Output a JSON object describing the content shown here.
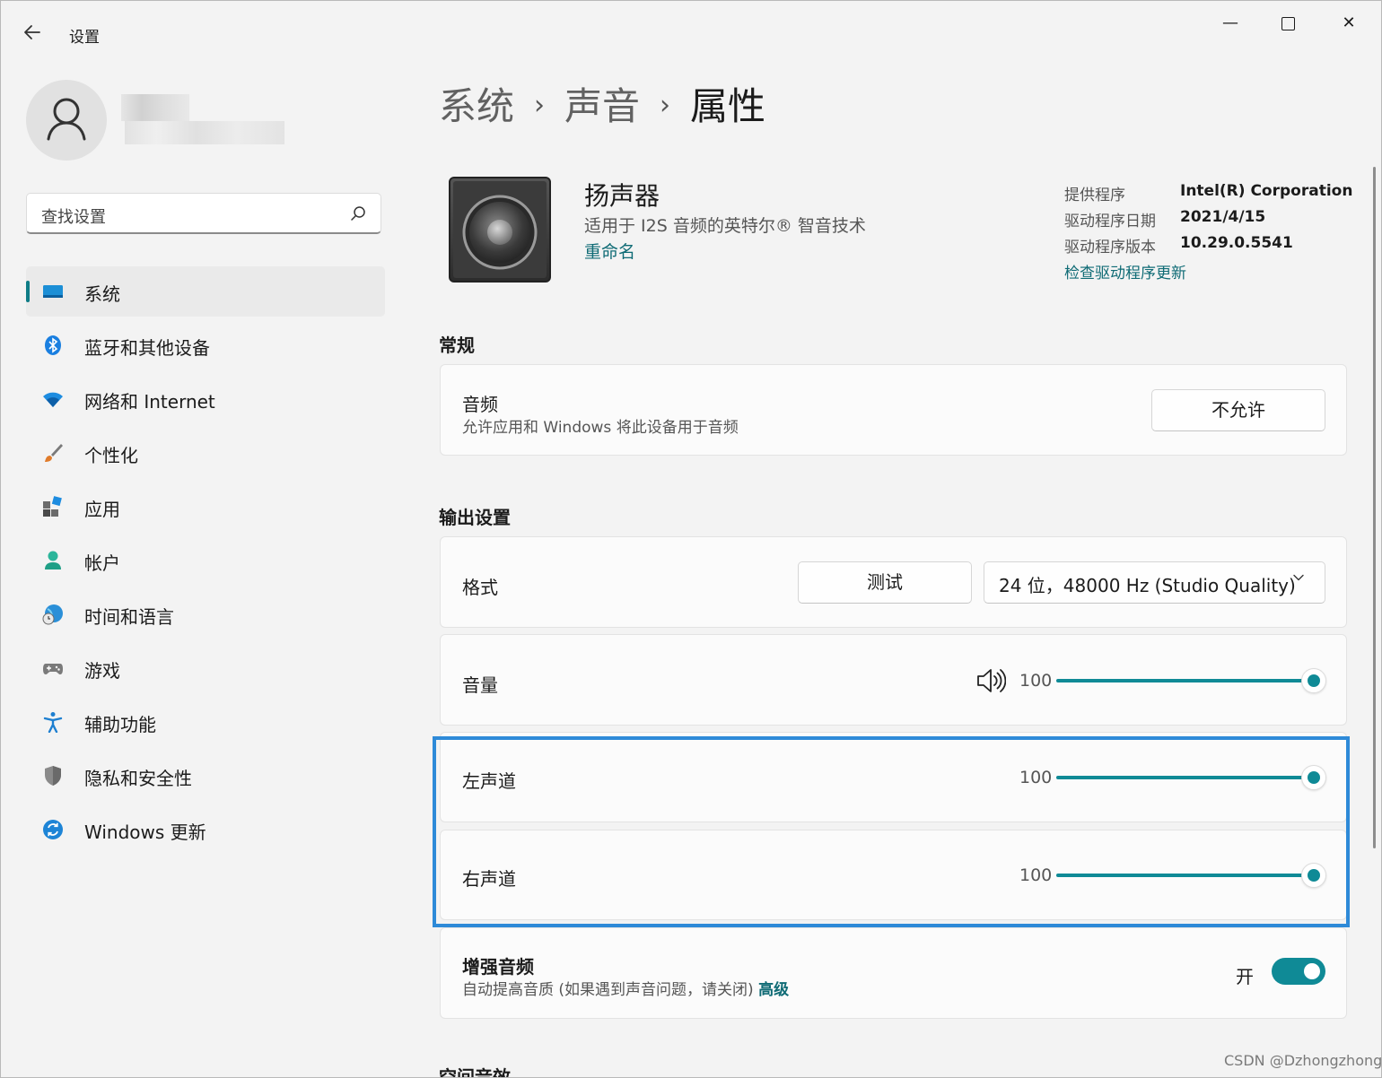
{
  "window": {
    "title": "设置",
    "controls": {
      "min": "—",
      "close": "✕"
    }
  },
  "search": {
    "placeholder": "查找设置"
  },
  "sidebar": {
    "items": [
      {
        "label": "系统",
        "icon": "system-icon",
        "active": true
      },
      {
        "label": "蓝牙和其他设备",
        "icon": "bluetooth-icon"
      },
      {
        "label": "网络和 Internet",
        "icon": "wifi-icon"
      },
      {
        "label": "个性化",
        "icon": "brush-icon"
      },
      {
        "label": "应用",
        "icon": "apps-icon"
      },
      {
        "label": "帐户",
        "icon": "account-icon"
      },
      {
        "label": "时间和语言",
        "icon": "time-language-icon"
      },
      {
        "label": "游戏",
        "icon": "gamepad-icon"
      },
      {
        "label": "辅助功能",
        "icon": "accessibility-icon"
      },
      {
        "label": "隐私和安全性",
        "icon": "shield-icon"
      },
      {
        "label": "Windows 更新",
        "icon": "update-icon"
      }
    ]
  },
  "breadcrumb": {
    "items": [
      "系统",
      "声音",
      "属性"
    ],
    "separator": "›"
  },
  "device": {
    "name": "扬声器",
    "description": "适用于 I2S 音频的英特尔® 智音技术",
    "rename": "重命名",
    "info": [
      {
        "label": "提供程序",
        "value": "Intel(R) Corporation"
      },
      {
        "label": "驱动程序日期",
        "value": "2021/4/15"
      },
      {
        "label": "驱动程序版本",
        "value": "10.29.0.5541"
      }
    ],
    "check_update": "检查驱动程序更新"
  },
  "general": {
    "heading": "常规",
    "audio": {
      "title": "音频",
      "subtitle": "允许应用和 Windows 将此设备用于音频",
      "button": "不允许"
    }
  },
  "output": {
    "heading": "输出设置",
    "format": {
      "title": "格式",
      "test_button": "测试",
      "selected": "24 位，48000 Hz (Studio Quality)"
    },
    "volume": {
      "title": "音量",
      "value": "100",
      "level": 1.0
    },
    "left": {
      "title": "左声道",
      "value": "100",
      "level": 1.0
    },
    "right": {
      "title": "右声道",
      "value": "100",
      "level": 1.0
    },
    "enhance": {
      "title": "增强音频",
      "subtitle": "自动提高音质 (如果遇到声音问题，请关闭)",
      "advanced": "高级",
      "state": "开",
      "on": true
    }
  },
  "next_heading": "空间音效",
  "watermark": "CSDN @Dzhongzhong",
  "colors": {
    "accent": "#0f8a96",
    "link": "#0f6b75",
    "highlight": "#2e8ad8"
  }
}
